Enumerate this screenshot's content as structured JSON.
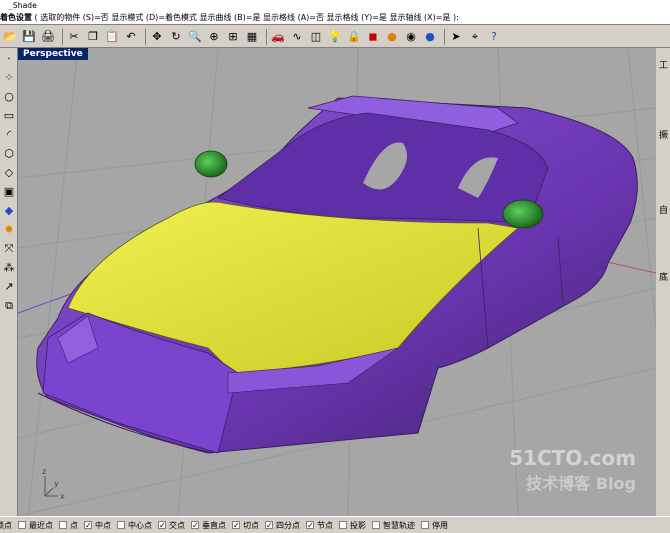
{
  "command_history": "_Shade",
  "command_prompt": {
    "label": "着色设置",
    "options": "( 选取的物件 (S)=否  显示模式 (D)=着色模式  显示曲线 (B)=是  显示格线 (A)=否  显示格线 (Y)=是  显示轴线 (X)=是 ):"
  },
  "viewport": {
    "title": "Perspective",
    "background": "#a6a6a6",
    "body_color": "#7b3fc4",
    "hood_color": "#e6e639",
    "mirror_color": "#2f9a2f",
    "axis_labels": {
      "x": "x",
      "y": "y",
      "z": "z"
    }
  },
  "toolbar_icons": [
    "open-icon",
    "save-icon",
    "print-icon",
    "cut-icon",
    "copy-icon",
    "paste-icon",
    "undo-icon",
    "pan-icon",
    "rotate-icon",
    "zoom-icon",
    "zoom-window-icon",
    "zoom-extents-icon",
    "grid-icon",
    "car-icon",
    "curve-icon",
    "layer-icon",
    "light-icon",
    "lock-icon",
    "material-icon",
    "color-icon",
    "render-icon",
    "sphere-icon",
    "cursor-icon",
    "snap-icon",
    "help-icon"
  ],
  "left_icons": [
    "point-icon",
    "dotted-icon",
    "circle-icon",
    "rectangle-icon",
    "arc-icon",
    "shape-icon",
    "surface-icon",
    "box-icon",
    "blend-icon",
    "explode-icon",
    "move-icon",
    "array-icon",
    "dim-icon",
    "group-icon"
  ],
  "right_panel_labels": [
    "工",
    "撅",
    "自",
    "底"
  ],
  "osnaps": [
    {
      "label": "最近点",
      "checked": false
    },
    {
      "label": "点",
      "checked": false
    },
    {
      "label": "中点",
      "checked": true
    },
    {
      "label": "中心点",
      "checked": false
    },
    {
      "label": "交点",
      "checked": true
    },
    {
      "label": "垂直点",
      "checked": true
    },
    {
      "label": "切点",
      "checked": true
    },
    {
      "label": "四分点",
      "checked": true
    },
    {
      "label": "节点",
      "checked": true
    },
    {
      "label": "投影",
      "checked": false
    },
    {
      "label": "智慧轨迹",
      "checked": false
    },
    {
      "label": "停用",
      "checked": false
    }
  ],
  "status_prefix": "锁点",
  "watermark": {
    "line1": "51CTO.com",
    "line2": "技术博客 Blog"
  }
}
